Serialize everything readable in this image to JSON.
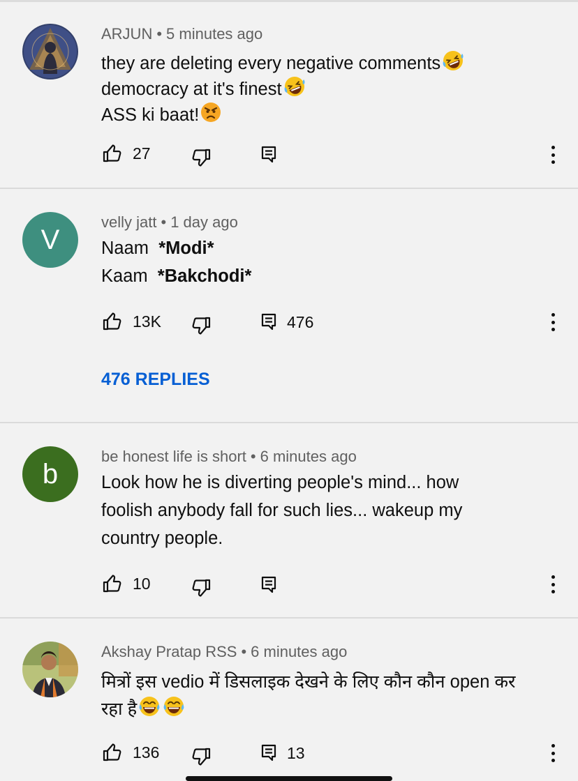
{
  "comments": [
    {
      "author": "ARJUN",
      "time": "5 minutes ago",
      "lines": [
        "they are deleting every negative comments",
        "democracy at it's finest",
        "ASS ki baat!"
      ],
      "likes": "27",
      "replies": ""
    },
    {
      "author": "velly jatt",
      "time": "1 day ago",
      "avatar_letter": "V",
      "avatar_color": "#3e8f7f",
      "line1_label": "Naam",
      "line1_value": "*Modi*",
      "line2_label": "Kaam",
      "line2_value": "*Bakchodi*",
      "likes": "13K",
      "replies": "476",
      "replies_link": "476 REPLIES"
    },
    {
      "author": "be honest life is short",
      "time": "6 minutes ago",
      "avatar_letter": "b",
      "avatar_color": "#3b6e1f",
      "lines": [
        "Look how he is diverting people's mind... how",
        "foolish anybody fall for such lies... wakeup my",
        "country people."
      ],
      "likes": "10",
      "replies": ""
    },
    {
      "author": "Akshay Pratap RSS",
      "time": "6 minutes ago",
      "lines": [
        "मित्रों इस vedio में डिसलाइक देखने के लिए कौन कौन open कर",
        "रहा है"
      ],
      "likes": "136",
      "replies": "13"
    }
  ],
  "meta_separator": "•",
  "icons": {
    "like": "thumb-up-icon",
    "dislike": "thumb-down-icon",
    "reply": "reply-icon",
    "menu": "more-vert-icon",
    "emoji_laugh": "rolling-laughing-emoji",
    "emoji_angry": "angry-face-emoji",
    "emoji_tears": "tears-of-joy-emoji"
  },
  "colors": {
    "background": "#f2f2f2",
    "link": "#065fd4",
    "meta": "#606060"
  }
}
